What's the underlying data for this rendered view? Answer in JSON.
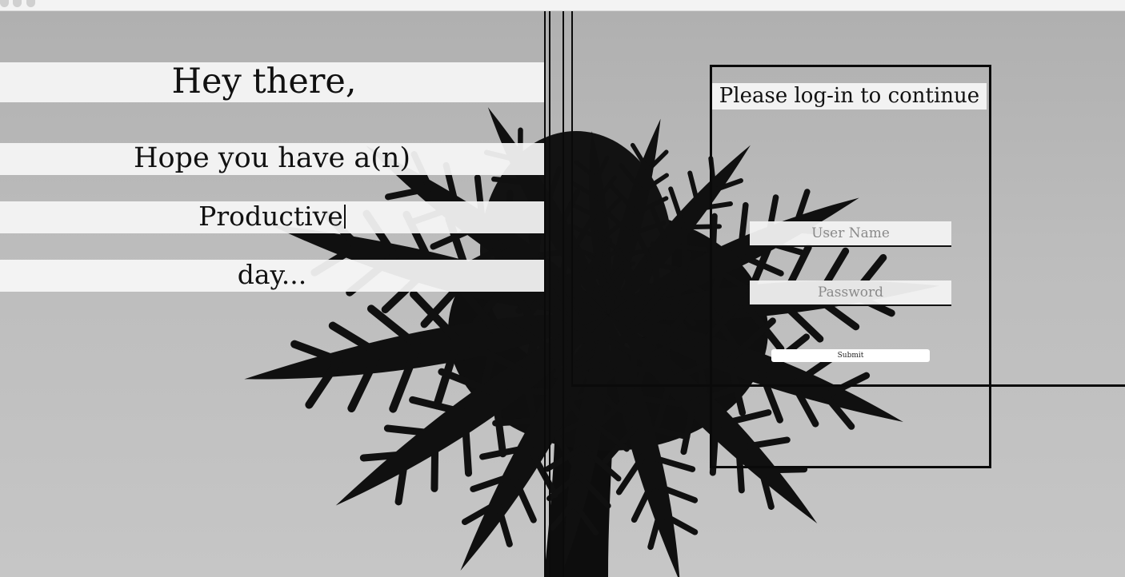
{
  "greeting": {
    "line1": "Hey there,",
    "line2": "Hope you have a(n)",
    "line3": "Productive",
    "line4": "day..."
  },
  "login": {
    "title": "Please log-in to continue",
    "username_placeholder": "User Name",
    "password_placeholder": "Password",
    "submit_label": "Submit"
  },
  "colors": {
    "band": "#f6f6f6",
    "line": "#0a0a0a",
    "sky": "#bdbdbd"
  }
}
